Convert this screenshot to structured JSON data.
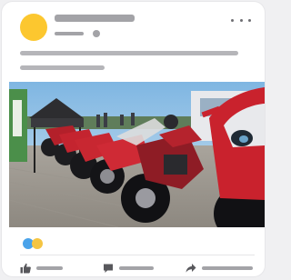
{
  "post": {
    "header": {
      "author_placeholder": "author-name-skeleton",
      "meta_placeholder": "post-meta-skeleton",
      "more_icon": "more-horizontal-icon"
    },
    "body_placeholder": "post-text-skeleton",
    "image": {
      "subject": "photo"
    },
    "reactions": [
      "like-reaction-icon",
      "love-reaction-icon"
    ],
    "actions": [
      {
        "icon": "thumbs-up-icon",
        "label": ""
      },
      {
        "icon": "comment-icon",
        "label": ""
      },
      {
        "icon": "share-icon",
        "label": ""
      }
    ]
  },
  "colors": {
    "avatar": "#fcc72f",
    "skeleton": "#a3a3a7",
    "skeleton_light": "#b5b5b9",
    "reaction_blue": "#4aa3ea",
    "reaction_yellow": "#f5c542",
    "action_icon": "#58585c"
  }
}
